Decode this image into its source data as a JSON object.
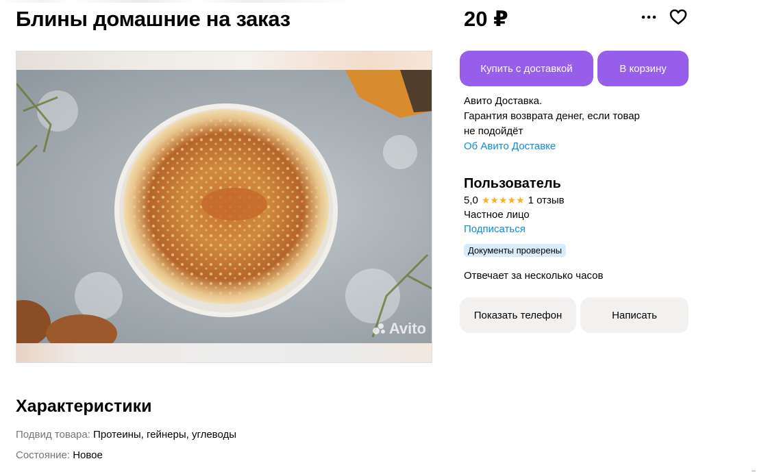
{
  "listing": {
    "title": "Блины домашние на заказ",
    "price": "20 ₽"
  },
  "gallery": {
    "watermark": "Avito"
  },
  "actions": {
    "buy_label": "Купить с доставкой",
    "cart_label": "В корзину",
    "more_icon": "more-horizontal-icon",
    "favorite_icon": "heart-outline-icon"
  },
  "delivery": {
    "line1": "Авито Доставка.",
    "line2": "Гарантия возврата денег, если товар",
    "line3": "не подойдёт",
    "link": "Об Авито Доставке"
  },
  "seller": {
    "name": "Пользователь",
    "rating": "5,0",
    "stars": "★★★★★",
    "reviews": "1 отзыв",
    "type": "Частное лицо",
    "subscribe": "Подписаться",
    "badge": "Документы проверены",
    "responds": "Отвечает за несколько часов",
    "phone_label": "Показать телефон",
    "write_label": "Написать"
  },
  "characteristics": {
    "title": "Характеристики",
    "items": [
      {
        "key": "Подвид товара:",
        "value": "Протеины, гейнеры, углеводы"
      },
      {
        "key": "Состояние:",
        "value": "Новое"
      }
    ]
  },
  "colors": {
    "accent": "#965eeb",
    "link": "#0a8ed9",
    "star": "#ffb021",
    "badge_bg": "#d8ecfb",
    "button_gray": "#f2f1f0"
  }
}
